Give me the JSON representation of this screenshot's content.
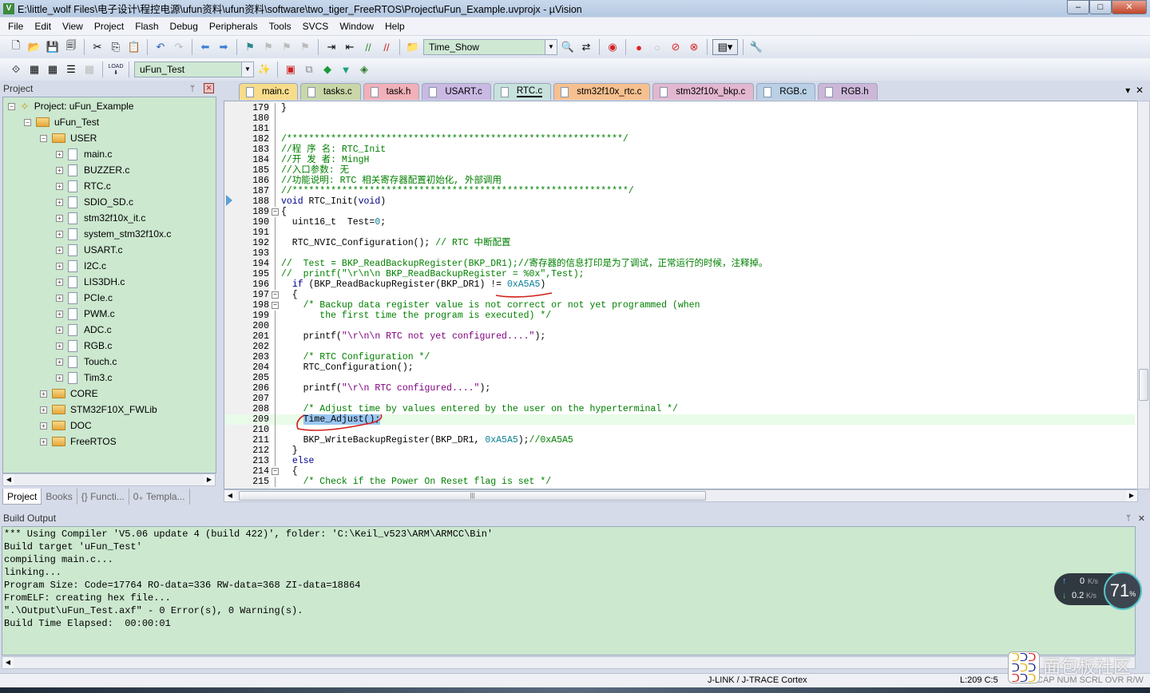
{
  "window": {
    "title": "E:\\little_wolf Files\\电子设计\\程控电源\\ufun资料\\ufun资料\\software\\two_tiger_FreeRTOS\\Project\\uFun_Example.uvprojx - µVision",
    "controls": [
      "–",
      "□",
      "✕"
    ]
  },
  "menu": [
    "File",
    "Edit",
    "View",
    "Project",
    "Flash",
    "Debug",
    "Peripherals",
    "Tools",
    "SVCS",
    "Window",
    "Help"
  ],
  "toolbar": {
    "find_combo": "Time_Show",
    "target_combo": "uFun_Test",
    "load_label": "LOAD"
  },
  "project_panel": {
    "title": "Project",
    "tree": [
      {
        "label": "Project: uFun_Example",
        "depth": 0,
        "kind": "project",
        "expanded": true
      },
      {
        "label": "uFun_Test",
        "depth": 1,
        "kind": "target",
        "expanded": true
      },
      {
        "label": "USER",
        "depth": 2,
        "kind": "folder",
        "expanded": true
      },
      {
        "label": "main.c",
        "depth": 3,
        "kind": "file"
      },
      {
        "label": "BUZZER.c",
        "depth": 3,
        "kind": "file"
      },
      {
        "label": "RTC.c",
        "depth": 3,
        "kind": "file"
      },
      {
        "label": "SDIO_SD.c",
        "depth": 3,
        "kind": "file"
      },
      {
        "label": "stm32f10x_it.c",
        "depth": 3,
        "kind": "file"
      },
      {
        "label": "system_stm32f10x.c",
        "depth": 3,
        "kind": "file"
      },
      {
        "label": "USART.c",
        "depth": 3,
        "kind": "file"
      },
      {
        "label": "I2C.c",
        "depth": 3,
        "kind": "file"
      },
      {
        "label": "LIS3DH.c",
        "depth": 3,
        "kind": "file"
      },
      {
        "label": "PCIe.c",
        "depth": 3,
        "kind": "file"
      },
      {
        "label": "PWM.c",
        "depth": 3,
        "kind": "file"
      },
      {
        "label": "ADC.c",
        "depth": 3,
        "kind": "file"
      },
      {
        "label": "RGB.c",
        "depth": 3,
        "kind": "file"
      },
      {
        "label": "Touch.c",
        "depth": 3,
        "kind": "file"
      },
      {
        "label": "Tim3.c",
        "depth": 3,
        "kind": "file"
      },
      {
        "label": "CORE",
        "depth": 2,
        "kind": "folder",
        "expanded": false
      },
      {
        "label": "STM32F10X_FWLib",
        "depth": 2,
        "kind": "folder",
        "expanded": false
      },
      {
        "label": "DOC",
        "depth": 2,
        "kind": "folder",
        "expanded": false
      },
      {
        "label": "FreeRTOS",
        "depth": 2,
        "kind": "folder",
        "expanded": false
      }
    ],
    "tabs": [
      {
        "label": "Project",
        "active": true
      },
      {
        "label": "Books"
      },
      {
        "label": "{} Functi..."
      },
      {
        "label": "0₊ Templa..."
      }
    ]
  },
  "editor": {
    "tabs": [
      {
        "label": "main.c",
        "color": "#f7dc8a"
      },
      {
        "label": "tasks.c",
        "color": "#c9d7a8"
      },
      {
        "label": "task.h",
        "color": "#f2b0b8"
      },
      {
        "label": "USART.c",
        "color": "#c9b9e3"
      },
      {
        "label": "RTC.c",
        "color": "#c7e2dc",
        "active": true
      },
      {
        "label": "stm32f10x_rtc.c",
        "color": "#f6c08f"
      },
      {
        "label": "stm32f10x_bkp.c",
        "color": "#e3b7d0"
      },
      {
        "label": "RGB.c",
        "color": "#b9d0e6"
      },
      {
        "label": "RGB.h",
        "color": "#cdb7d9"
      }
    ],
    "current_line": 209,
    "lines": [
      {
        "n": "179",
        "s": [
          [
            "}",
            ""
          ]
        ]
      },
      {
        "n": "180",
        "s": []
      },
      {
        "n": "181",
        "s": []
      },
      {
        "n": "182",
        "s": [
          [
            "/*************************************************************/",
            "c-com"
          ]
        ]
      },
      {
        "n": "183",
        "s": [
          [
            "//程 序 名: RTC_Init",
            "c-com"
          ]
        ]
      },
      {
        "n": "184",
        "s": [
          [
            "//开 发 者: MingH",
            "c-com"
          ]
        ]
      },
      {
        "n": "185",
        "s": [
          [
            "//入口参数: 无",
            "c-com"
          ]
        ]
      },
      {
        "n": "186",
        "s": [
          [
            "//功能说明: RTC 相关寄存器配置初始化, 外部调用",
            "c-com"
          ]
        ]
      },
      {
        "n": "187",
        "s": [
          [
            "//*************************************************************/",
            "c-com"
          ]
        ]
      },
      {
        "n": "188",
        "s": [
          [
            "void",
            "c-kw"
          ],
          [
            " RTC_Init(",
            ""
          ],
          [
            "void",
            "c-kw"
          ],
          [
            ")",
            ""
          ]
        ]
      },
      {
        "n": "189",
        "s": [
          [
            "{",
            ""
          ]
        ],
        "fold": "⊟"
      },
      {
        "n": "190",
        "s": [
          [
            "  uint16_t  Test=",
            ""
          ],
          [
            "0",
            "c-num"
          ],
          [
            ";",
            ""
          ]
        ]
      },
      {
        "n": "191",
        "s": []
      },
      {
        "n": "192",
        "s": [
          [
            "  RTC_NVIC_Configuration(); ",
            ""
          ],
          [
            "// RTC 中断配置",
            "c-com"
          ]
        ]
      },
      {
        "n": "193",
        "s": []
      },
      {
        "n": "194",
        "s": [
          [
            "//  Test = BKP_ReadBackupRegister(BKP_DR1);//寄存器的信息打印是为了调试，正常运行的时候，注释掉。",
            "c-com"
          ]
        ]
      },
      {
        "n": "195",
        "s": [
          [
            "//  printf(\"\\r\\n\\n BKP_ReadBackupRegister = %0x\",Test);",
            "c-com"
          ]
        ]
      },
      {
        "n": "196",
        "s": [
          [
            "  ",
            ""
          ],
          [
            "if",
            "c-kw"
          ],
          [
            " (BKP_ReadBackupRegister(BKP_DR1) != ",
            ""
          ],
          [
            "0xA5A5",
            "c-num"
          ],
          [
            ")",
            ""
          ]
        ]
      },
      {
        "n": "197",
        "s": [
          [
            "  {",
            ""
          ]
        ],
        "fold": "⊟"
      },
      {
        "n": "198",
        "s": [
          [
            "    /* Backup data register value is not correct or not yet programmed (when",
            "c-com"
          ]
        ],
        "fold": "⊟"
      },
      {
        "n": "199",
        "s": [
          [
            "       the first time the program is executed) */",
            "c-com"
          ]
        ]
      },
      {
        "n": "200",
        "s": []
      },
      {
        "n": "201",
        "s": [
          [
            "    printf(",
            ""
          ],
          [
            "\"\\r\\n\\n RTC not yet configured....\"",
            "c-str"
          ],
          [
            ");",
            ""
          ]
        ]
      },
      {
        "n": "202",
        "s": []
      },
      {
        "n": "203",
        "s": [
          [
            "    /* RTC Configuration */",
            "c-com"
          ]
        ]
      },
      {
        "n": "204",
        "s": [
          [
            "    RTC_Configuration();",
            ""
          ]
        ]
      },
      {
        "n": "205",
        "s": []
      },
      {
        "n": "206",
        "s": [
          [
            "    printf(",
            ""
          ],
          [
            "\"\\r\\n RTC configured....\"",
            "c-str"
          ],
          [
            ");",
            ""
          ]
        ]
      },
      {
        "n": "207",
        "s": []
      },
      {
        "n": "208",
        "s": [
          [
            "    /* Adjust time by values entered by the user on the hyperterminal */",
            "c-com"
          ]
        ]
      },
      {
        "n": "209",
        "s": [
          [
            "    ",
            ""
          ],
          [
            "Time_Adjust();",
            "c-sel"
          ]
        ]
      },
      {
        "n": "210",
        "s": []
      },
      {
        "n": "211",
        "s": [
          [
            "    BKP_WriteBackupRegister(BKP_DR1, ",
            ""
          ],
          [
            "0xA5A5",
            "c-num"
          ],
          [
            ");",
            ""
          ],
          [
            "//0xA5A5",
            "c-com"
          ]
        ]
      },
      {
        "n": "212",
        "s": [
          [
            "  }",
            ""
          ]
        ]
      },
      {
        "n": "213",
        "s": [
          [
            "  ",
            ""
          ],
          [
            "else",
            "c-kw"
          ]
        ]
      },
      {
        "n": "214",
        "s": [
          [
            "  {",
            ""
          ]
        ],
        "fold": "⊟"
      },
      {
        "n": "215",
        "s": [
          [
            "    /* Check if the Power On Reset flag is set */",
            "c-com"
          ]
        ]
      }
    ]
  },
  "build_output": {
    "title": "Build Output",
    "lines": [
      "*** Using Compiler 'V5.06 update 4 (build 422)', folder: 'C:\\Keil_v523\\ARM\\ARMCC\\Bin'",
      "Build target 'uFun_Test'",
      "compiling main.c...",
      "linking...",
      "Program Size: Code=17764 RO-data=336 RW-data=368 ZI-data=18864",
      "FromELF: creating hex file...",
      "\".\\Output\\uFun_Test.axf\" - 0 Error(s), 0 Warning(s).",
      "Build Time Elapsed:  00:00:01"
    ]
  },
  "status": {
    "debugger": "J-LINK / J-TRACE Cortex",
    "position": "L:209 C:5",
    "flags": "CAP NUM SCRL OVR R/W"
  },
  "net_widget": {
    "up": "0",
    "down": "0.2",
    "unit": "K/s",
    "percent": "71",
    "percent_sign": "%"
  },
  "watermark": "面包板社区"
}
